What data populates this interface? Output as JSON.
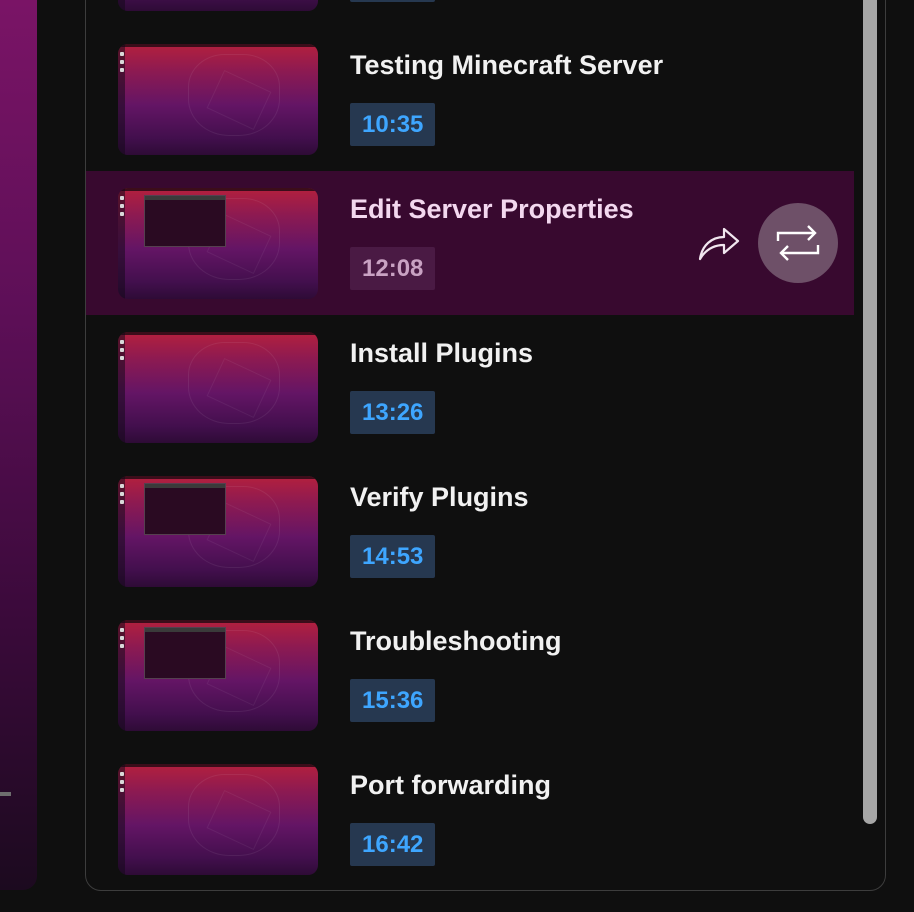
{
  "chapters": [
    {
      "title": "",
      "time": ""
    },
    {
      "title": "Testing Minecraft Server",
      "time": "10:35"
    },
    {
      "title": "Edit Server Properties",
      "time": "12:08"
    },
    {
      "title": "Install Plugins",
      "time": "13:26"
    },
    {
      "title": "Verify Plugins",
      "time": "14:53"
    },
    {
      "title": "Troubleshooting",
      "time": "15:36"
    },
    {
      "title": "Port forwarding",
      "time": "16:42"
    }
  ],
  "active_index": 2,
  "actions": {
    "share_icon": "share-icon",
    "loop_icon": "loop-icon"
  },
  "colors": {
    "accent": "#3ea6ff",
    "active_row": "#38092f",
    "timestamp_bg": "#263850"
  }
}
